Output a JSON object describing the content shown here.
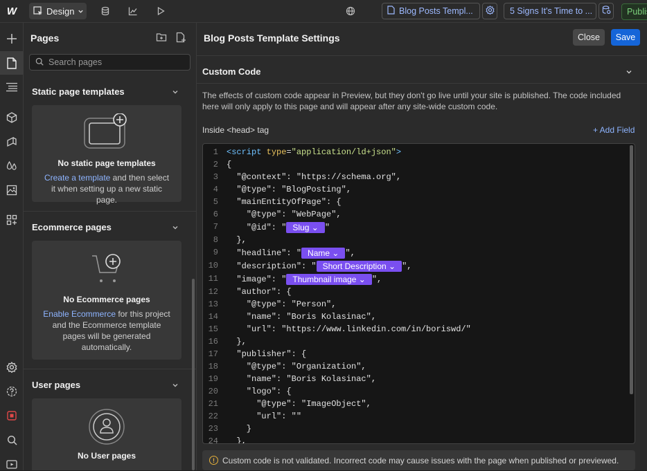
{
  "topbar": {
    "design_label": "Design",
    "page_pill": "Blog Posts Templ...",
    "item_pill": "5 Signs It's Time to ...",
    "publish_label": "Publis"
  },
  "pages_panel": {
    "title": "Pages",
    "search_placeholder": "Search pages",
    "static": {
      "title": "Static page templates",
      "empty_title": "No static page templates",
      "link": "Create a template",
      "text": " and then select it when setting up a new static page."
    },
    "ecommerce": {
      "title": "Ecommerce pages",
      "empty_title": "No Ecommerce pages",
      "link": "Enable Ecommerce",
      "text": " for this project and the Ecommerce template pages will be generated automatically."
    },
    "user": {
      "title": "User pages",
      "empty_title": "No User pages"
    }
  },
  "settings": {
    "title": "Blog Posts Template Settings",
    "close_label": "Close",
    "save_label": "Save",
    "section_title": "Custom Code",
    "description": "The effects of custom code appear in Preview, but they don't go live until your site is published. The code included here will only apply to this page and will appear after any site-wide custom code.",
    "inside_label": "Inside <head> tag",
    "add_field_label": "+ Add Field",
    "warning": "Custom code is not validated. Incorrect code may cause issues with the page when published or previewed."
  },
  "code": {
    "line_numbers": [
      "1",
      "2",
      "3",
      "4",
      "5",
      "6",
      "7",
      "8",
      "9",
      "10",
      "11",
      "12",
      "13",
      "14",
      "15",
      "16",
      "17",
      "18",
      "19",
      "20",
      "21",
      "22",
      "23",
      "24"
    ],
    "l1_open": "<script",
    "l1_attr": " type",
    "l1_eq": "=",
    "l1_val": "\"application/ld+json\"",
    "l1_close": ">",
    "l2": "{",
    "l3": "  \"@context\": \"https://schema.org\",",
    "l4": "  \"@type\": \"BlogPosting\",",
    "l5": "  \"mainEntityOfPage\": {",
    "l6": "    \"@type\": \"WebPage\",",
    "l7a": "    \"@id\": \"",
    "l7_chip": "Slug",
    "l7b": "\"",
    "l8": "  },",
    "l9a": "  \"headline\": \"",
    "l9_chip": "Name",
    "l9b": "\",",
    "l10a": "  \"description\": \"",
    "l10_chip": "Short Description",
    "l10b": "\",",
    "l11a": "  \"image\": \"",
    "l11_chip": "Thumbnail image",
    "l11b": "\",",
    "l12": "  \"author\": {",
    "l13": "    \"@type\": \"Person\",",
    "l14": "    \"name\": \"Boris Kolasinac\",",
    "l15": "    \"url\": \"https://www.linkedin.com/in/boriswd/\"",
    "l16": "  },",
    "l17": "  \"publisher\": {",
    "l18": "    \"@type\": \"Organization\",",
    "l19": "    \"name\": \"Boris Kolasinac\",",
    "l20": "    \"logo\": {",
    "l21": "      \"@type\": \"ImageObject\",",
    "l22": "      \"url\": \"\"",
    "l23": "    }",
    "l24": "  },"
  }
}
